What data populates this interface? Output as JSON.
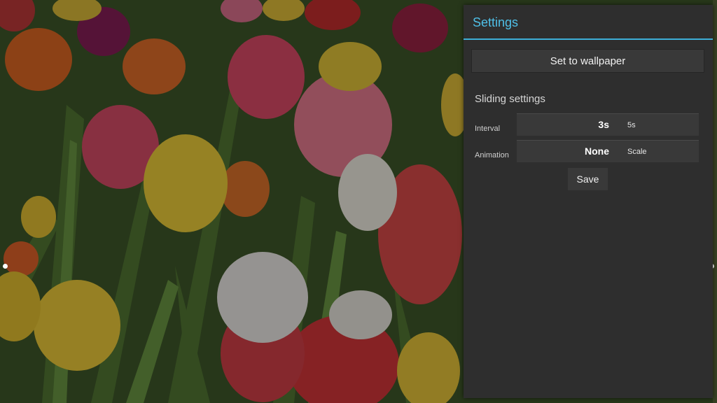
{
  "background": {
    "description_icon": "tulip-field-photo"
  },
  "panel": {
    "title": "Settings",
    "wallpaper_button": "Set to wallpaper",
    "section_title": "Sliding settings",
    "interval": {
      "label": "Interval",
      "current": "3s",
      "next": "5s"
    },
    "animation": {
      "label": "Animation",
      "current": "None",
      "next": "Scale"
    },
    "save_button": "Save"
  },
  "colors": {
    "accent": "#4fc0e8",
    "panel_bg": "#2e2e2e",
    "button_bg": "#393939"
  }
}
